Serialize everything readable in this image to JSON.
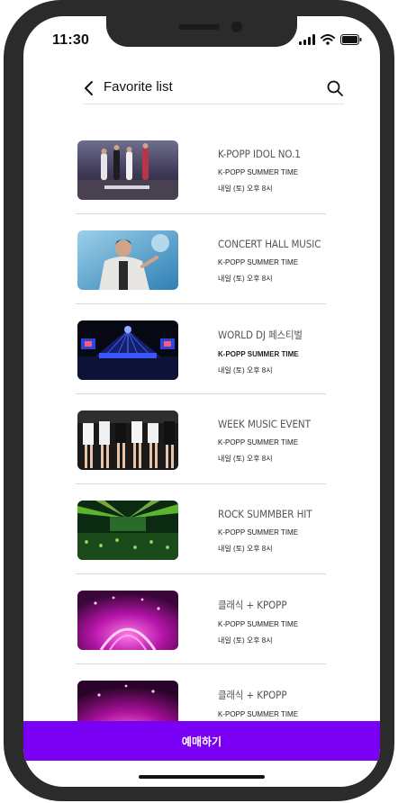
{
  "status_bar": {
    "time": "11:30"
  },
  "header": {
    "title": "Favorite list"
  },
  "items": [
    {
      "title": "K-POPP IDOL NO.1",
      "subtitle": "K-POPP SUMMER TIME",
      "subtitle_bold": false,
      "time": "내일 (토) 오후 8시"
    },
    {
      "title": "CONCERT HALL MUSIC",
      "subtitle": "K-POPP SUMMER TIME",
      "subtitle_bold": false,
      "time": "내일 (토) 오후 8시"
    },
    {
      "title": "WORLD DJ 페스티벌",
      "subtitle": "K-POPP SUMMER TIME",
      "subtitle_bold": true,
      "time": "내일 (토) 오후 8시"
    },
    {
      "title": "WEEK MUSIC EVENT",
      "subtitle": "K-POPP SUMMER TIME",
      "subtitle_bold": false,
      "time": "내일 (토) 오후 8시"
    },
    {
      "title": "ROCK SUMMBER HIT",
      "subtitle": "K-POPP SUMMER TIME",
      "subtitle_bold": false,
      "time": "내일 (토) 오후 8시"
    },
    {
      "title": "클래식 + KPOPP",
      "subtitle": "K-POPP SUMMER TIME",
      "subtitle_bold": false,
      "time": "내일 (토) 오후 8시"
    },
    {
      "title": "클래식 + KPOPP",
      "subtitle": "K-POPP SUMMER TIME",
      "subtitle_bold": false,
      "time": ""
    }
  ],
  "reserve_button": {
    "label": "예매하기"
  },
  "colors": {
    "accent": "#7a00f5",
    "frame": "#2b2b2b",
    "divider": "#d8d8d8"
  },
  "icons": {
    "back": "chevron-left-icon",
    "search": "search-icon",
    "signal": "signal-icon",
    "wifi": "wifi-icon",
    "battery": "battery-icon"
  }
}
